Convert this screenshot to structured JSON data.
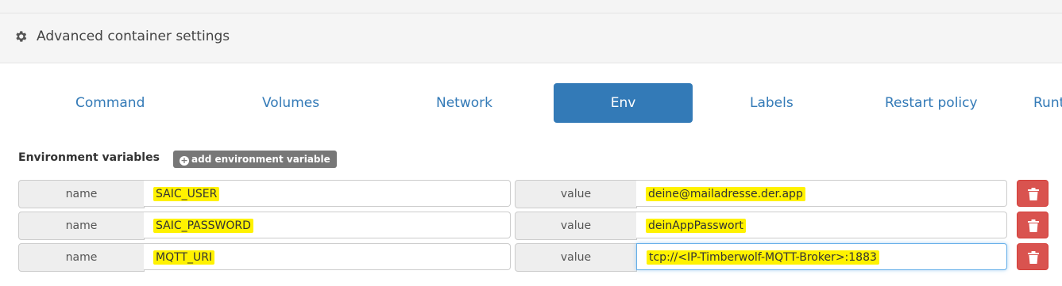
{
  "panel": {
    "title": "Advanced container settings",
    "icon": "gear-icon"
  },
  "tabs": [
    {
      "label": "Command",
      "active": false
    },
    {
      "label": "Volumes",
      "active": false
    },
    {
      "label": "Network",
      "active": false
    },
    {
      "label": "Env",
      "active": true
    },
    {
      "label": "Labels",
      "active": false
    },
    {
      "label": "Restart policy",
      "active": false
    },
    {
      "label": "Runt",
      "active": false
    }
  ],
  "env": {
    "section_label": "Environment variables",
    "add_button_label": "add environment variable",
    "name_addon": "name",
    "value_addon": "value",
    "rows": [
      {
        "name": "SAIC_USER",
        "value": "deine@mailadresse.der.app"
      },
      {
        "name": "SAIC_PASSWORD",
        "value": "deinAppPasswort"
      },
      {
        "name": "MQTT_URI",
        "value": "tcp://<IP-Timberwolf-MQTT-Broker>:1883"
      }
    ]
  },
  "colors": {
    "accent": "#337ab7",
    "danger": "#d9534f",
    "highlight": "#fff200"
  }
}
